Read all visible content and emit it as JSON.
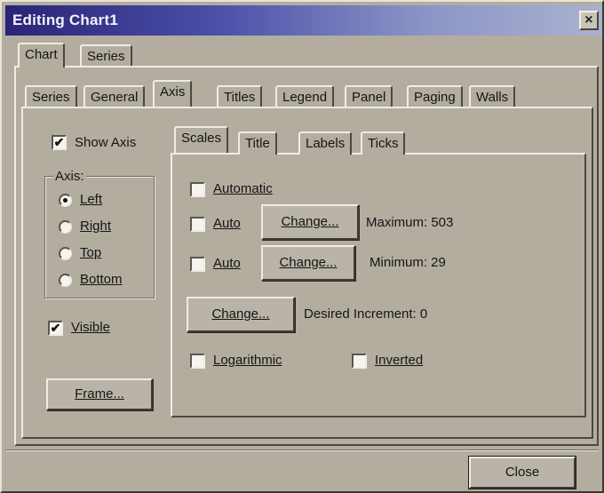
{
  "window": {
    "title": "Editing Chart1"
  },
  "top_tabs": {
    "chart": "Chart",
    "series": "Series"
  },
  "chart_tabs": {
    "series": "Series",
    "general": "General",
    "axis": "Axis",
    "titles": "Titles",
    "legend": "Legend",
    "panel": "Panel",
    "paging": "Paging",
    "walls": "Walls"
  },
  "axis_panel": {
    "show_axis": {
      "label": "Show Axis",
      "checked": true
    },
    "axis_group": {
      "title": "Axis:",
      "options": {
        "left": "Left",
        "right": "Right",
        "top": "Top",
        "bottom": "Bottom"
      },
      "selected": "Left"
    },
    "visible": {
      "label": "Visible",
      "checked": true
    },
    "frame_button": "Frame..."
  },
  "sub_tabs": {
    "scales": "Scales",
    "title": "Title",
    "labels": "Labels",
    "ticks": "Ticks"
  },
  "scales": {
    "automatic": {
      "label": "Automatic",
      "checked": false
    },
    "auto_max": {
      "label": "Auto",
      "checked": false
    },
    "change_max": "Change...",
    "maximum_text": "Maximum: 503",
    "auto_min": {
      "label": "Auto",
      "checked": false
    },
    "change_min": "Change...",
    "minimum_text": "Minimum: 29",
    "change_increment": "Change...",
    "desired_increment_text": "Desired Increment: 0",
    "logarithmic": {
      "label": "Logarithmic",
      "checked": false
    },
    "inverted": {
      "label": "Inverted",
      "checked": false
    }
  },
  "footer": {
    "close_button": "Close"
  },
  "colors": {
    "face": "#b3ada0",
    "title_start": "#2a2477",
    "title_end": "#aab2d0"
  }
}
